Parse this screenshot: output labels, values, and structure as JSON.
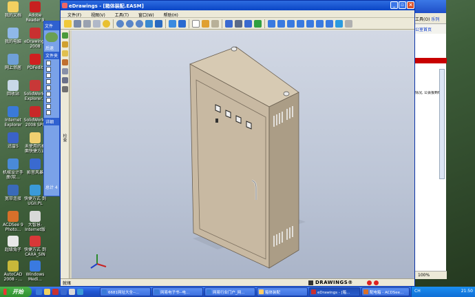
{
  "desktop": {
    "icons": [
      {
        "label": "我的文档",
        "color": "#f2d060"
      },
      {
        "label": "我的电脑",
        "color": "#8fb8e8"
      },
      {
        "label": "网上邻居",
        "color": "#6fa0d8"
      },
      {
        "label": "回收站",
        "color": "#c8d8e8"
      },
      {
        "label": "Internet Explorer",
        "color": "#3a7ad8"
      },
      {
        "label": "迅雷5",
        "color": "#3a62c8"
      },
      {
        "label": "机械设计手册(软...",
        "color": "#4a8ad8"
      },
      {
        "label": "宽带连接",
        "color": "#3a6ab8"
      },
      {
        "label": "ACDSee 9 Photo...",
        "color": "#d8702a"
      },
      {
        "label": "超级兔子",
        "color": "#e8e8e8"
      },
      {
        "label": "AutoCAD 2008 - ...",
        "color": "#c8b83a"
      },
      {
        "label": "Adobe Reader 9",
        "color": "#c82020"
      },
      {
        "label": "eDrawings 2008",
        "color": "#c83030"
      },
      {
        "label": "PDFedit",
        "color": "#d02020"
      },
      {
        "label": "SolidWorks Explorer...",
        "color": "#c83838"
      },
      {
        "label": "SolidWorks 2008 SP0",
        "color": "#c82828"
      },
      {
        "label": "未使用的桌面快捷方式",
        "color": "#f0d070"
      },
      {
        "label": "影音风暴",
        "color": "#3a6ad0"
      },
      {
        "label": "快捷方式 到 UGII.PL",
        "color": "#3a9ad8"
      },
      {
        "label": "大智慧-Internet版",
        "color": "#d8d8d8"
      },
      {
        "label": "快捷方式 到 CAXA_SIN",
        "color": "#d83838"
      },
      {
        "label": "Windows Medi...",
        "color": "#3a7ae0"
      }
    ]
  },
  "bg_window": {
    "toolbar_text": "工具(O)",
    "link_text": "乐列",
    "link2_text": "公室首页",
    "body_text": "情况,\n公会报到600",
    "zoom": "100%"
  },
  "left_panel": {
    "header": "文件",
    "back_label": "后退",
    "section_label": "文件夹",
    "bottom_label": "详细",
    "footer_label": "总计 4"
  },
  "window": {
    "title": "eDrawings - [箱体装配.EASM]",
    "menu": [
      "文件(F)",
      "视图(V)",
      "工具(T)",
      "窗口(W)",
      "帮助(H)"
    ],
    "side_label": "检查",
    "status_text": "就绪",
    "brand": "DRAWINGS®"
  },
  "toolbar": {
    "icons": [
      "open-icon",
      "save-icon",
      "print-icon",
      "print-preview-icon",
      "help-icon",
      "zoom-fit-icon",
      "zoom-icon",
      "zoom-area-icon",
      "rotate-icon",
      "pan-icon",
      "view-3d-icon",
      "view-solid-icon",
      "select-icon",
      "explode-icon",
      "section-icon",
      "first-icon",
      "stop-icon",
      "next-icon",
      "play-icon",
      "view-front-icon",
      "view-back-icon",
      "view-left-icon",
      "view-right-icon",
      "view-top-icon",
      "view-bottom-icon",
      "view-iso-icon",
      "light-icon"
    ]
  },
  "taskbar": {
    "start_label": "开始",
    "tasks": [
      {
        "label": "6681网址大全--..."
      },
      {
        "label": "网易电子书--电..."
      },
      {
        "label": "网易行业门户_网..."
      },
      {
        "label": "箱体装配"
      },
      {
        "label": "eDrawings - [箱..."
      },
      {
        "label": "配电箱 - ACDSee..."
      }
    ],
    "tray_lang": "CH",
    "clock": "21:50"
  },
  "colors": {
    "cabinet_front": "#c8b9a2",
    "cabinet_side": "#ab9d86",
    "cabinet_top": "#d7cab3",
    "title_blue": "#0a45c6"
  }
}
